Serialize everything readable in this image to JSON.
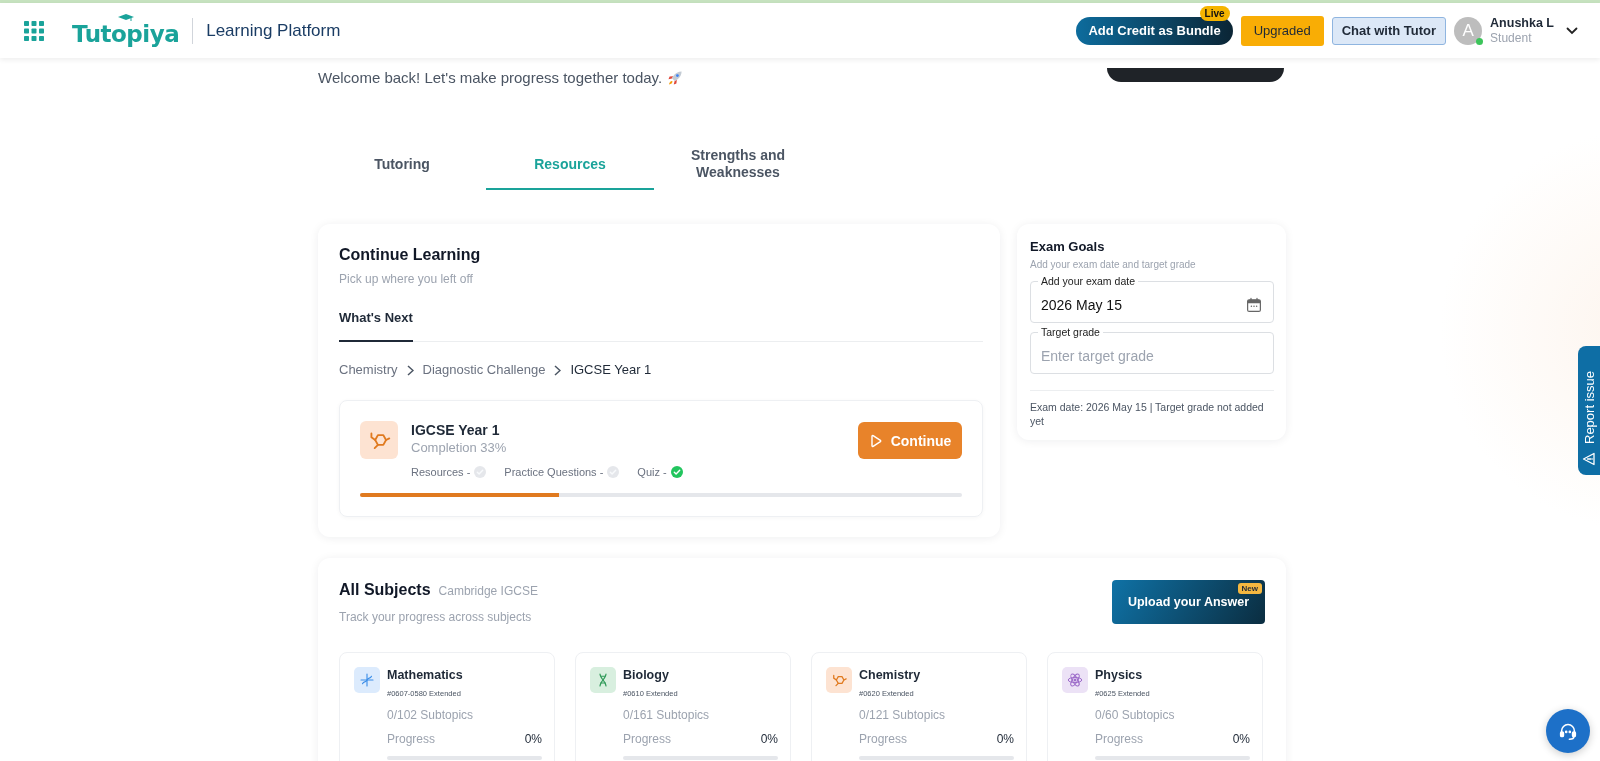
{
  "header": {
    "logo": "Tutopiya",
    "title": "Learning Platform",
    "actions": [
      {
        "kind": "bundle",
        "label": "Add Credit as Bundle",
        "badge": "Live"
      },
      {
        "kind": "upgrade",
        "label": "Upgraded"
      },
      {
        "kind": "chat",
        "label": "Chat with Tutor"
      }
    ],
    "user": {
      "initial": "A",
      "name": "Anushka L",
      "role": "Student",
      "online": true
    }
  },
  "welcome": "Welcome back! Let's make progress together today.",
  "tabs": [
    {
      "label": "Tutoring",
      "selected": false
    },
    {
      "label": "Resources",
      "selected": true
    },
    {
      "label": "Strengths and Weaknesses",
      "selected": false
    }
  ],
  "continue_learning": {
    "title": "Continue Learning",
    "subtitle": "Pick up where you left off",
    "tabs": [
      {
        "label": "What's Next",
        "selected": true
      }
    ],
    "breadcrumb": [
      "Chemistry",
      "Diagnostic Challenge",
      "IGCSE Year 1"
    ],
    "course": {
      "kind": "chemistry",
      "title": "IGCSE Year 1",
      "completion": "Completion 33%",
      "steps": [
        {
          "label": "Resources -",
          "checked": false
        },
        {
          "label": "Practice Questions -",
          "checked": false
        },
        {
          "label": "Quiz -",
          "checked": true
        }
      ],
      "level": 0.33,
      "button": "Continue"
    }
  },
  "exam_goals": {
    "title": "Exam Goals",
    "subtitle": "Add your exam date and target grade",
    "fields": [
      {
        "kind": "date",
        "label": "Add your exam date",
        "value": "2026 May 15"
      },
      {
        "kind": "text",
        "label": "Target grade",
        "placeholder": "Enter target grade"
      }
    ],
    "summary": "Exam date: 2026 May 15 | Target grade not added yet"
  },
  "all_subjects": {
    "title": "All Subjects",
    "board": "Cambridge IGCSE",
    "subtitle": "Track your progress across subjects",
    "upload_button": {
      "label": "Upload your Answer",
      "badge": "New"
    },
    "subjects": [
      {
        "kind": "math",
        "name": "Mathematics",
        "code": "#0607-0580 Extended",
        "subtopics": "0/102 Subtopics",
        "progress_label": "Progress",
        "progress": "0%"
      },
      {
        "kind": "biology",
        "name": "Biology",
        "code": "#0610 Extended",
        "subtopics": "0/161 Subtopics",
        "progress_label": "Progress",
        "progress": "0%"
      },
      {
        "kind": "chemistry",
        "name": "Chemistry",
        "code": "#0620 Extended",
        "subtopics": "0/121 Subtopics",
        "progress_label": "Progress",
        "progress": "0%"
      },
      {
        "kind": "physics",
        "name": "Physics",
        "code": "#0625 Extended",
        "subtopics": "0/60 Subtopics",
        "progress_label": "Progress",
        "progress": "0%"
      }
    ]
  },
  "report_issue": {
    "label": "Report issue"
  }
}
